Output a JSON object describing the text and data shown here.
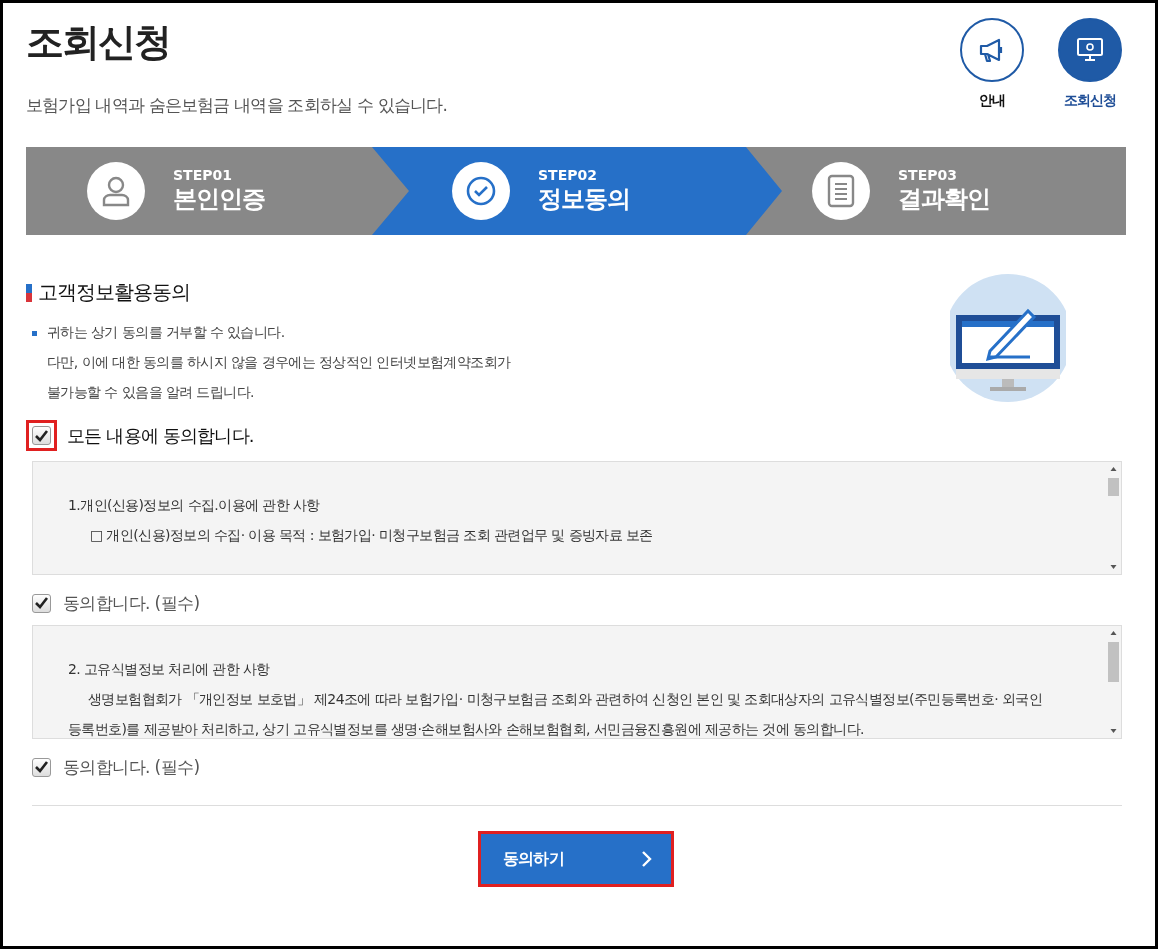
{
  "header": {
    "title": "조회신청",
    "subtitle": "보험가입 내역과 숨은보험금 내역을 조회하실 수 있습니다."
  },
  "quick_links": [
    {
      "label": "안내",
      "kind": "megaphone",
      "selected": false
    },
    {
      "label": "조회신청",
      "kind": "monitor",
      "selected": true
    }
  ],
  "steps": [
    {
      "step": "STEP01",
      "label": "본인인증",
      "kind": "person",
      "selected": false
    },
    {
      "step": "STEP02",
      "label": "정보동의",
      "kind": "check",
      "selected": true
    },
    {
      "step": "STEP03",
      "label": "결과확인",
      "kind": "document",
      "selected": false
    }
  ],
  "section": {
    "title": "고객정보활용동의",
    "notes": [
      "귀하는 상기 동의를 거부할 수 있습니다.",
      "다만, 이에 대한 동의를 하시지 않을 경우에는 정상적인 인터넷보험계약조회가",
      "불가능할 수 있음을 알려 드립니다."
    ]
  },
  "agree_all": {
    "label": "모든 내용에 동의합니다.",
    "checked": true,
    "highlighted": true
  },
  "terms": [
    {
      "heading": "1.개인(신용)정보의 수집.이용에 관한 사항",
      "body": "□ 개인(신용)정보의 수집· 이용 목적 : 보험가입· 미청구보험금 조회 관련업무 및 증빙자료 보존",
      "kind": "indented",
      "agree": {
        "label": "동의합니다. (필수)",
        "checked": true
      }
    },
    {
      "heading": "2. 고유식별정보 처리에 관한 사항",
      "body": "생명보험협회가 「개인정보 보호법」 제24조에 따라 보험가입· 미청구보험금 조회와 관련하여 신청인 본인 및 조회대상자의 고유식별정보(주민등록번호· 외국인등록번호)를 제공받아 처리하고, 상기 고유식별정보를 생명·손해보험사와 손해보험협회, 서민금융진흥원에 제공하는 것에 동의합니다.",
      "kind": "paragraph",
      "agree": {
        "label": "동의합니다. (필수)",
        "checked": true
      }
    }
  ],
  "submit": {
    "label": "동의하기",
    "highlighted": true
  }
}
